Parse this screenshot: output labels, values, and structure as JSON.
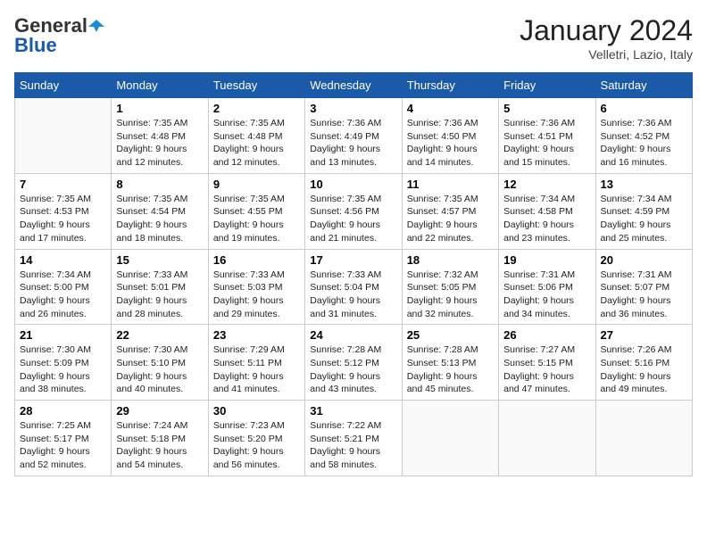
{
  "header": {
    "logo_general": "General",
    "logo_blue": "Blue",
    "month_title": "January 2024",
    "location": "Velletri, Lazio, Italy"
  },
  "weekdays": [
    "Sunday",
    "Monday",
    "Tuesday",
    "Wednesday",
    "Thursday",
    "Friday",
    "Saturday"
  ],
  "weeks": [
    [
      {
        "day": "",
        "info": ""
      },
      {
        "day": "1",
        "info": "Sunrise: 7:35 AM\nSunset: 4:48 PM\nDaylight: 9 hours\nand 12 minutes."
      },
      {
        "day": "2",
        "info": "Sunrise: 7:35 AM\nSunset: 4:48 PM\nDaylight: 9 hours\nand 12 minutes."
      },
      {
        "day": "3",
        "info": "Sunrise: 7:36 AM\nSunset: 4:49 PM\nDaylight: 9 hours\nand 13 minutes."
      },
      {
        "day": "4",
        "info": "Sunrise: 7:36 AM\nSunset: 4:50 PM\nDaylight: 9 hours\nand 14 minutes."
      },
      {
        "day": "5",
        "info": "Sunrise: 7:36 AM\nSunset: 4:51 PM\nDaylight: 9 hours\nand 15 minutes."
      },
      {
        "day": "6",
        "info": "Sunrise: 7:36 AM\nSunset: 4:52 PM\nDaylight: 9 hours\nand 16 minutes."
      }
    ],
    [
      {
        "day": "7",
        "info": "Sunrise: 7:35 AM\nSunset: 4:53 PM\nDaylight: 9 hours\nand 17 minutes."
      },
      {
        "day": "8",
        "info": "Sunrise: 7:35 AM\nSunset: 4:54 PM\nDaylight: 9 hours\nand 18 minutes."
      },
      {
        "day": "9",
        "info": "Sunrise: 7:35 AM\nSunset: 4:55 PM\nDaylight: 9 hours\nand 19 minutes."
      },
      {
        "day": "10",
        "info": "Sunrise: 7:35 AM\nSunset: 4:56 PM\nDaylight: 9 hours\nand 21 minutes."
      },
      {
        "day": "11",
        "info": "Sunrise: 7:35 AM\nSunset: 4:57 PM\nDaylight: 9 hours\nand 22 minutes."
      },
      {
        "day": "12",
        "info": "Sunrise: 7:34 AM\nSunset: 4:58 PM\nDaylight: 9 hours\nand 23 minutes."
      },
      {
        "day": "13",
        "info": "Sunrise: 7:34 AM\nSunset: 4:59 PM\nDaylight: 9 hours\nand 25 minutes."
      }
    ],
    [
      {
        "day": "14",
        "info": "Sunrise: 7:34 AM\nSunset: 5:00 PM\nDaylight: 9 hours\nand 26 minutes."
      },
      {
        "day": "15",
        "info": "Sunrise: 7:33 AM\nSunset: 5:01 PM\nDaylight: 9 hours\nand 28 minutes."
      },
      {
        "day": "16",
        "info": "Sunrise: 7:33 AM\nSunset: 5:03 PM\nDaylight: 9 hours\nand 29 minutes."
      },
      {
        "day": "17",
        "info": "Sunrise: 7:33 AM\nSunset: 5:04 PM\nDaylight: 9 hours\nand 31 minutes."
      },
      {
        "day": "18",
        "info": "Sunrise: 7:32 AM\nSunset: 5:05 PM\nDaylight: 9 hours\nand 32 minutes."
      },
      {
        "day": "19",
        "info": "Sunrise: 7:31 AM\nSunset: 5:06 PM\nDaylight: 9 hours\nand 34 minutes."
      },
      {
        "day": "20",
        "info": "Sunrise: 7:31 AM\nSunset: 5:07 PM\nDaylight: 9 hours\nand 36 minutes."
      }
    ],
    [
      {
        "day": "21",
        "info": "Sunrise: 7:30 AM\nSunset: 5:09 PM\nDaylight: 9 hours\nand 38 minutes."
      },
      {
        "day": "22",
        "info": "Sunrise: 7:30 AM\nSunset: 5:10 PM\nDaylight: 9 hours\nand 40 minutes."
      },
      {
        "day": "23",
        "info": "Sunrise: 7:29 AM\nSunset: 5:11 PM\nDaylight: 9 hours\nand 41 minutes."
      },
      {
        "day": "24",
        "info": "Sunrise: 7:28 AM\nSunset: 5:12 PM\nDaylight: 9 hours\nand 43 minutes."
      },
      {
        "day": "25",
        "info": "Sunrise: 7:28 AM\nSunset: 5:13 PM\nDaylight: 9 hours\nand 45 minutes."
      },
      {
        "day": "26",
        "info": "Sunrise: 7:27 AM\nSunset: 5:15 PM\nDaylight: 9 hours\nand 47 minutes."
      },
      {
        "day": "27",
        "info": "Sunrise: 7:26 AM\nSunset: 5:16 PM\nDaylight: 9 hours\nand 49 minutes."
      }
    ],
    [
      {
        "day": "28",
        "info": "Sunrise: 7:25 AM\nSunset: 5:17 PM\nDaylight: 9 hours\nand 52 minutes."
      },
      {
        "day": "29",
        "info": "Sunrise: 7:24 AM\nSunset: 5:18 PM\nDaylight: 9 hours\nand 54 minutes."
      },
      {
        "day": "30",
        "info": "Sunrise: 7:23 AM\nSunset: 5:20 PM\nDaylight: 9 hours\nand 56 minutes."
      },
      {
        "day": "31",
        "info": "Sunrise: 7:22 AM\nSunset: 5:21 PM\nDaylight: 9 hours\nand 58 minutes."
      },
      {
        "day": "",
        "info": ""
      },
      {
        "day": "",
        "info": ""
      },
      {
        "day": "",
        "info": ""
      }
    ]
  ]
}
